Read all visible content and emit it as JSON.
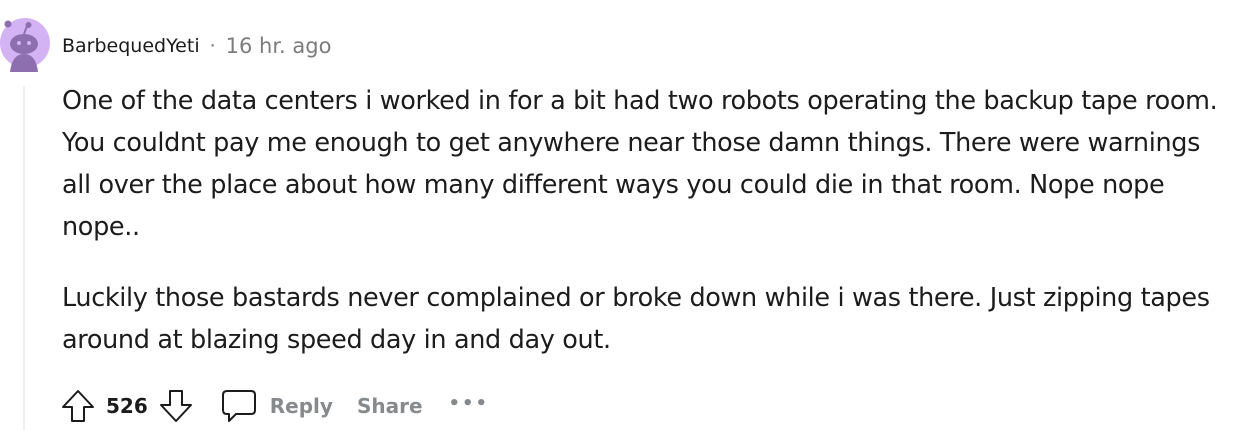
{
  "comment": {
    "author": "BarbequedYeti",
    "separator": "·",
    "timestamp": "16 hr. ago",
    "paragraphs": [
      "One of the data centers i worked in for a bit had two robots operating the backup tape room. You couldnt pay me enough to get anywhere near those damn things. There were warnings all over the place about how many different ways you could die in that room. Nope nope nope..",
      "Luckily those bastards never complained or broke down while i was there. Just zipping tapes around at blazing speed day in and day out."
    ]
  },
  "actions": {
    "vote_count": "526",
    "reply_label": "Reply",
    "share_label": "Share",
    "more_label": "•••"
  },
  "icons": {
    "avatar": "snoo-avatar-icon",
    "upvote": "arrow-up-icon",
    "downvote": "arrow-down-icon",
    "reply": "speech-bubble-icon",
    "more": "ellipsis-icon"
  },
  "colors": {
    "text": "#1c1c1c",
    "meta_gray": "#7c7c7c",
    "action_gray": "#878a8c",
    "avatar_bg": "#d4b3f5",
    "avatar_snoo": "#8d6fb0",
    "thread_line": "#edeff1"
  }
}
